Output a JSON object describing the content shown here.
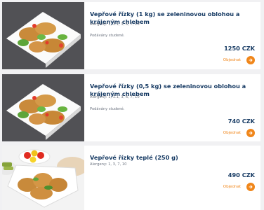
{
  "colors": {
    "accent": "#f0861a",
    "title": "#163a63",
    "text": "#6d7480",
    "background": "#f1f1f3"
  },
  "products": [
    {
      "title": "Vepřové řízky (1 kg) se zeleninovou oblohou a krájeným chlebem",
      "allergens": "Alergeny: 1, 1.1, 3, 6, 7, 10",
      "note": "Podávány studené.",
      "price": "1250 CZK",
      "order_label": "Objednat",
      "order_icon": "arrow-right-icon"
    },
    {
      "title": "Vepřové řízky (0,5 kg) se zeleninovou oblohou a krájeným chlebem",
      "allergens": "Alergeny: 1, 1.1, 3, 6, 7, 10",
      "note": "Podávány studené.",
      "price": "740 CZK",
      "order_label": "Objednat",
      "order_icon": "arrow-right-icon"
    },
    {
      "title": "Vepřové řízky teplé (250 g)",
      "allergens": "Alergeny: 1, 3, 7, 10",
      "price": "490 CZK",
      "order_label": "Objednat",
      "order_icon": "arrow-right-icon"
    }
  ]
}
